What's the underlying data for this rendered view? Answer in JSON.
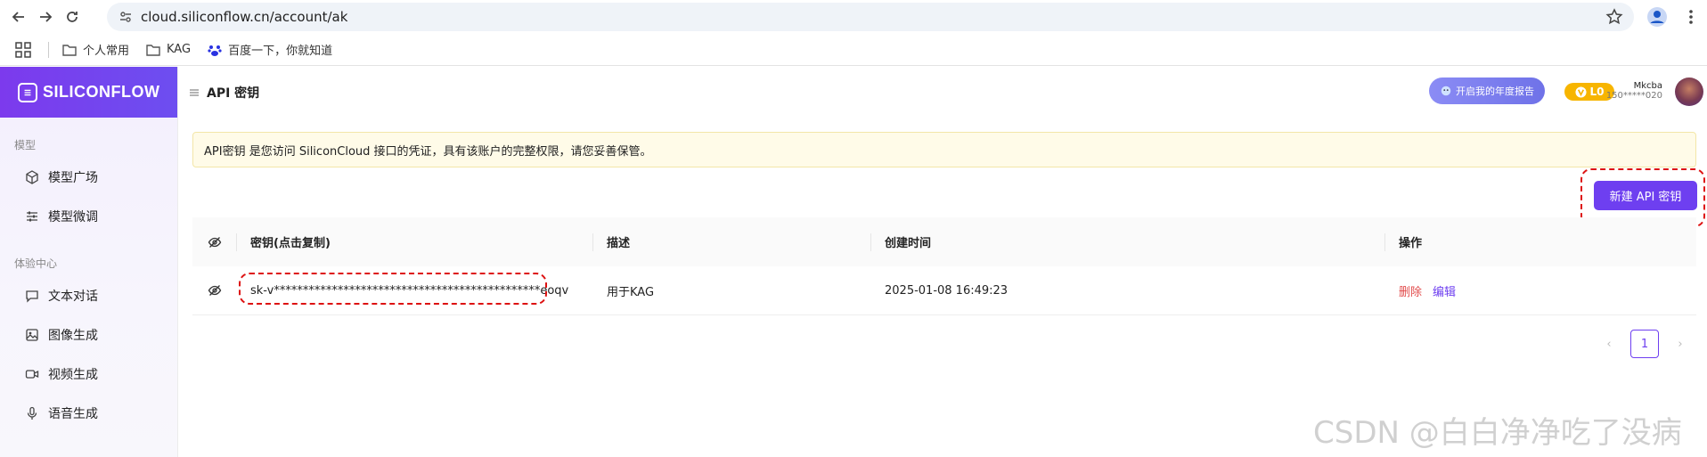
{
  "browser": {
    "url": "cloud.siliconflow.cn/account/ak",
    "bookmarks": [
      "个人常用",
      "KAG",
      "百度一下，你就知道"
    ]
  },
  "sidebar": {
    "logo": "SILICONFLOW",
    "sections": [
      {
        "title": "模型",
        "items": [
          {
            "label": "模型广场",
            "icon": "cube-icon"
          },
          {
            "label": "模型微调",
            "icon": "sliders-icon"
          }
        ]
      },
      {
        "title": "体验中心",
        "items": [
          {
            "label": "文本对话",
            "icon": "chat-icon"
          },
          {
            "label": "图像生成",
            "icon": "image-icon"
          },
          {
            "label": "视频生成",
            "icon": "video-icon"
          },
          {
            "label": "语音生成",
            "icon": "mic-icon"
          }
        ]
      }
    ]
  },
  "header": {
    "title": "API 密钥",
    "report_button": "开启我的年度报告",
    "level": "L0",
    "user_name": "Mkcba",
    "user_phone": "150*****020"
  },
  "notice": "API密钥 是您访问 SiliconCloud 接口的凭证，具有该账户的完整权限，请您妥善保管。",
  "new_key_button": "新建 API 密钥",
  "table": {
    "headers": {
      "key": "密钥(点击复制)",
      "desc": "描述",
      "time": "创建时间",
      "ops": "操作"
    },
    "rows": [
      {
        "key": "sk-v**********************************************eoqv",
        "desc": "用于KAG",
        "time": "2025-01-08 16:49:23",
        "delete": "删除",
        "edit": "编辑"
      }
    ]
  },
  "pagination": {
    "current": "1"
  },
  "watermark": "CSDN @白白净净吃了没病"
}
